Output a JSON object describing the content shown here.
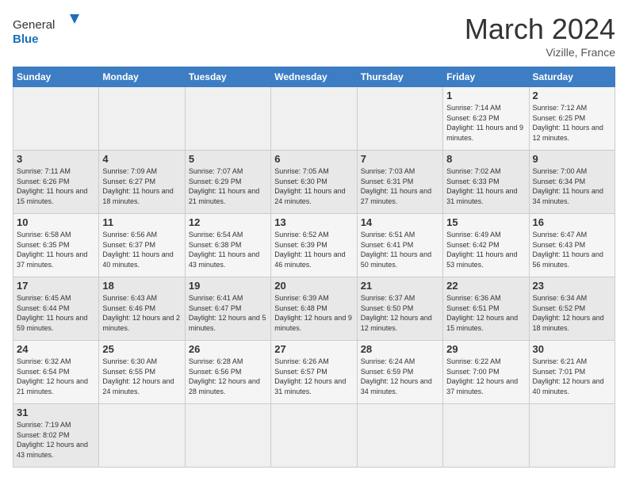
{
  "header": {
    "logo_general": "General",
    "logo_blue": "Blue",
    "month_title": "March 2024",
    "location": "Vizille, France"
  },
  "days_of_week": [
    "Sunday",
    "Monday",
    "Tuesday",
    "Wednesday",
    "Thursday",
    "Friday",
    "Saturday"
  ],
  "weeks": [
    {
      "days": [
        {
          "num": "",
          "info": ""
        },
        {
          "num": "",
          "info": ""
        },
        {
          "num": "",
          "info": ""
        },
        {
          "num": "",
          "info": ""
        },
        {
          "num": "",
          "info": ""
        },
        {
          "num": "1",
          "info": "Sunrise: 7:14 AM\nSunset: 6:23 PM\nDaylight: 11 hours\nand 9 minutes."
        },
        {
          "num": "2",
          "info": "Sunrise: 7:12 AM\nSunset: 6:25 PM\nDaylight: 11 hours\nand 12 minutes."
        }
      ]
    },
    {
      "days": [
        {
          "num": "3",
          "info": "Sunrise: 7:11 AM\nSunset: 6:26 PM\nDaylight: 11 hours\nand 15 minutes."
        },
        {
          "num": "4",
          "info": "Sunrise: 7:09 AM\nSunset: 6:27 PM\nDaylight: 11 hours\nand 18 minutes."
        },
        {
          "num": "5",
          "info": "Sunrise: 7:07 AM\nSunset: 6:29 PM\nDaylight: 11 hours\nand 21 minutes."
        },
        {
          "num": "6",
          "info": "Sunrise: 7:05 AM\nSunset: 6:30 PM\nDaylight: 11 hours\nand 24 minutes."
        },
        {
          "num": "7",
          "info": "Sunrise: 7:03 AM\nSunset: 6:31 PM\nDaylight: 11 hours\nand 27 minutes."
        },
        {
          "num": "8",
          "info": "Sunrise: 7:02 AM\nSunset: 6:33 PM\nDaylight: 11 hours\nand 31 minutes."
        },
        {
          "num": "9",
          "info": "Sunrise: 7:00 AM\nSunset: 6:34 PM\nDaylight: 11 hours\nand 34 minutes."
        }
      ]
    },
    {
      "days": [
        {
          "num": "10",
          "info": "Sunrise: 6:58 AM\nSunset: 6:35 PM\nDaylight: 11 hours\nand 37 minutes."
        },
        {
          "num": "11",
          "info": "Sunrise: 6:56 AM\nSunset: 6:37 PM\nDaylight: 11 hours\nand 40 minutes."
        },
        {
          "num": "12",
          "info": "Sunrise: 6:54 AM\nSunset: 6:38 PM\nDaylight: 11 hours\nand 43 minutes."
        },
        {
          "num": "13",
          "info": "Sunrise: 6:52 AM\nSunset: 6:39 PM\nDaylight: 11 hours\nand 46 minutes."
        },
        {
          "num": "14",
          "info": "Sunrise: 6:51 AM\nSunset: 6:41 PM\nDaylight: 11 hours\nand 50 minutes."
        },
        {
          "num": "15",
          "info": "Sunrise: 6:49 AM\nSunset: 6:42 PM\nDaylight: 11 hours\nand 53 minutes."
        },
        {
          "num": "16",
          "info": "Sunrise: 6:47 AM\nSunset: 6:43 PM\nDaylight: 11 hours\nand 56 minutes."
        }
      ]
    },
    {
      "days": [
        {
          "num": "17",
          "info": "Sunrise: 6:45 AM\nSunset: 6:44 PM\nDaylight: 11 hours\nand 59 minutes."
        },
        {
          "num": "18",
          "info": "Sunrise: 6:43 AM\nSunset: 6:46 PM\nDaylight: 12 hours\nand 2 minutes."
        },
        {
          "num": "19",
          "info": "Sunrise: 6:41 AM\nSunset: 6:47 PM\nDaylight: 12 hours\nand 5 minutes."
        },
        {
          "num": "20",
          "info": "Sunrise: 6:39 AM\nSunset: 6:48 PM\nDaylight: 12 hours\nand 9 minutes."
        },
        {
          "num": "21",
          "info": "Sunrise: 6:37 AM\nSunset: 6:50 PM\nDaylight: 12 hours\nand 12 minutes."
        },
        {
          "num": "22",
          "info": "Sunrise: 6:36 AM\nSunset: 6:51 PM\nDaylight: 12 hours\nand 15 minutes."
        },
        {
          "num": "23",
          "info": "Sunrise: 6:34 AM\nSunset: 6:52 PM\nDaylight: 12 hours\nand 18 minutes."
        }
      ]
    },
    {
      "days": [
        {
          "num": "24",
          "info": "Sunrise: 6:32 AM\nSunset: 6:54 PM\nDaylight: 12 hours\nand 21 minutes."
        },
        {
          "num": "25",
          "info": "Sunrise: 6:30 AM\nSunset: 6:55 PM\nDaylight: 12 hours\nand 24 minutes."
        },
        {
          "num": "26",
          "info": "Sunrise: 6:28 AM\nSunset: 6:56 PM\nDaylight: 12 hours\nand 28 minutes."
        },
        {
          "num": "27",
          "info": "Sunrise: 6:26 AM\nSunset: 6:57 PM\nDaylight: 12 hours\nand 31 minutes."
        },
        {
          "num": "28",
          "info": "Sunrise: 6:24 AM\nSunset: 6:59 PM\nDaylight: 12 hours\nand 34 minutes."
        },
        {
          "num": "29",
          "info": "Sunrise: 6:22 AM\nSunset: 7:00 PM\nDaylight: 12 hours\nand 37 minutes."
        },
        {
          "num": "30",
          "info": "Sunrise: 6:21 AM\nSunset: 7:01 PM\nDaylight: 12 hours\nand 40 minutes."
        }
      ]
    },
    {
      "days": [
        {
          "num": "31",
          "info": "Sunrise: 7:19 AM\nSunset: 8:02 PM\nDaylight: 12 hours\nand 43 minutes."
        },
        {
          "num": "",
          "info": ""
        },
        {
          "num": "",
          "info": ""
        },
        {
          "num": "",
          "info": ""
        },
        {
          "num": "",
          "info": ""
        },
        {
          "num": "",
          "info": ""
        },
        {
          "num": "",
          "info": ""
        }
      ]
    }
  ]
}
